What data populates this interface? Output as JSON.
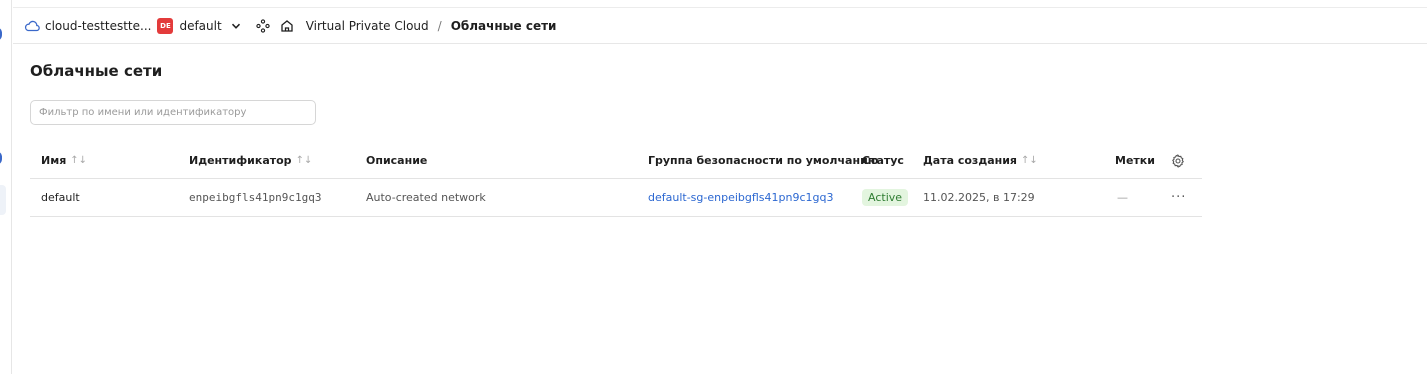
{
  "topbar": {
    "cloud_name": "cloud-testtestte...",
    "folder_badge": "DE",
    "folder_name": "default",
    "breadcrumb": {
      "service": "Virtual Private Cloud",
      "separator": "/",
      "current": "Облачные сети"
    }
  },
  "page": {
    "title": "Облачные сети",
    "filter_placeholder": "Фильтр по имени или идентификатору"
  },
  "table": {
    "columns": {
      "name": "Имя",
      "id": "Идентификатор",
      "description": "Описание",
      "security_group": "Группа безопасности по умолчанию",
      "status": "Статус",
      "created": "Дата создания",
      "labels": "Метки"
    },
    "sort_glyph": "↑↓",
    "rows": [
      {
        "name": "default",
        "id": "enpeibgfls41pn9c1gq3",
        "description": "Auto-created network",
        "security_group": "default-sg-enpeibgfls41pn9c1gq3",
        "status": "Active",
        "created": "11.02.2025, в 17:29",
        "labels": "—",
        "actions": "···"
      }
    ]
  },
  "colors": {
    "accent": "#2b67d1",
    "status_bg": "#e3f5df",
    "status_fg": "#2f7d32",
    "folder_badge": "#e33b3b"
  }
}
